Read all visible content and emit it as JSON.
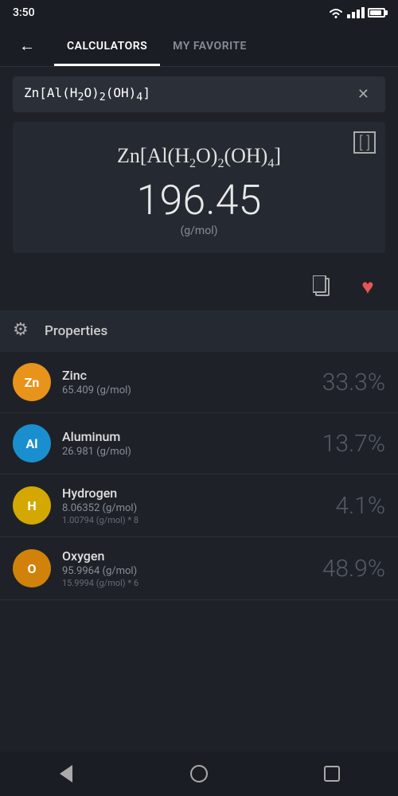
{
  "statusBar": {
    "time": "3:50"
  },
  "topNav": {
    "backLabel": "←",
    "tab1Label": "CALCULATORS",
    "tab2Label": "MY FAVORITE",
    "tab1Active": true
  },
  "searchBar": {
    "value": "Zn[Al(H₂O)₂(OH)₄]",
    "clearLabel": "✕"
  },
  "formulaCard": {
    "formulaDisplay": "Zn[Al(H₂O)₂(OH)₄]",
    "weight": "196.45",
    "unit": "(g/mol)",
    "expandLabel": "[ ]"
  },
  "actions": {
    "copyLabel": "copy",
    "favoriteLabel": "♥"
  },
  "propertiesSection": {
    "title": "Properties",
    "gearIcon": "⚙"
  },
  "elements": [
    {
      "symbol": "Zn",
      "color": "#e8931a",
      "name": "Zinc",
      "mass": "65.409 (g/mol)",
      "sub": "",
      "percent": "33.3%"
    },
    {
      "symbol": "Al",
      "color": "#1a8fcf",
      "name": "Aluminum",
      "mass": "26.981 (g/mol)",
      "sub": "",
      "percent": "13.7%"
    },
    {
      "symbol": "H",
      "color": "#d4a800",
      "name": "Hydrogen",
      "mass": "8.06352 (g/mol)",
      "sub": "1.00794 (g/mol) * 8",
      "percent": "4.1%"
    },
    {
      "symbol": "O",
      "color": "#d0820a",
      "name": "Oxygen",
      "mass": "95.9964 (g/mol)",
      "sub": "15.9994 (g/mol) * 6",
      "percent": "48.9%"
    }
  ],
  "bottomNav": {
    "backLabel": "back",
    "homeLabel": "home",
    "recentLabel": "recent"
  }
}
